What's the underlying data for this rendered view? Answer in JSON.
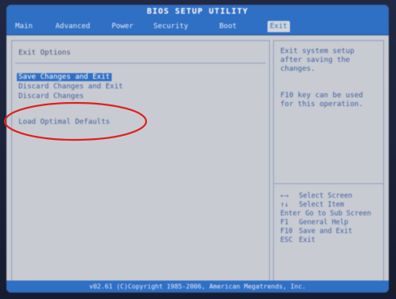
{
  "title_bar": {
    "title": "BIOS SETUP UTILITY"
  },
  "menu": {
    "tabs": [
      {
        "label": "Main"
      },
      {
        "label": "Advanced"
      },
      {
        "label": "Power"
      },
      {
        "label": "Security"
      },
      {
        "label": "Boot"
      },
      {
        "label": "Exit"
      }
    ],
    "active_index": 5
  },
  "main": {
    "section_title": "Exit Options",
    "options": [
      {
        "label": "Save Changes and Exit",
        "selected": true
      },
      {
        "label": "Discard Changes and Exit",
        "selected": false
      },
      {
        "label": "Discard Changes",
        "selected": false
      },
      {
        "label": "Load Optimal Defaults",
        "selected": false
      }
    ]
  },
  "help": {
    "description_lines": [
      "Exit system setup",
      "after saving the",
      "changes."
    ],
    "hotkey_lines": [
      "F10 key can be used",
      "for this operation."
    ],
    "keys": [
      {
        "key": "←→",
        "action": "Select Screen"
      },
      {
        "key": "↑↓",
        "action": "Select Item"
      },
      {
        "key": "Enter",
        "action": "Go to Sub Screen"
      },
      {
        "key": "F1",
        "action": "General Help"
      },
      {
        "key": "F10",
        "action": "Save and Exit"
      },
      {
        "key": "ESC",
        "action": "Exit"
      }
    ]
  },
  "footer": {
    "text": "v02.61 (C)Copyright 1985-2006, American Megatrends, Inc."
  },
  "colors": {
    "bios_blue": "#2f6fc4",
    "bios_gray": "#c8cbd2",
    "annotation_red": "#e02020"
  }
}
